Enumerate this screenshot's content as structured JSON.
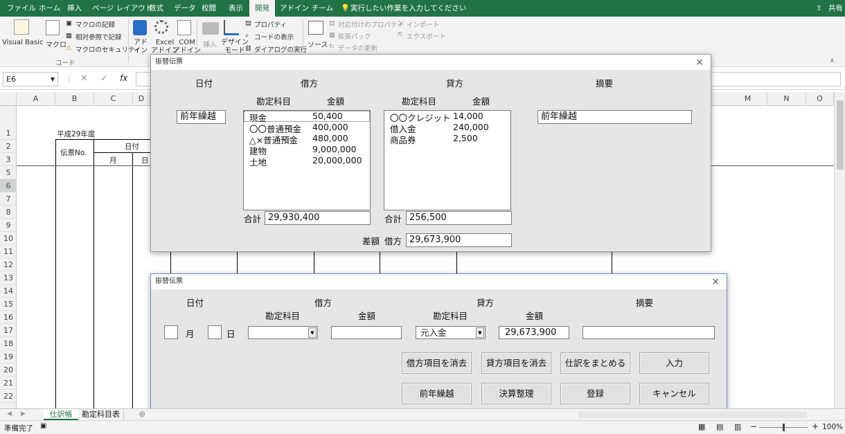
{
  "ribbon": {
    "tabs": [
      "ファイル",
      "ホーム",
      "挿入",
      "ページ レイアウト",
      "数式",
      "データ",
      "校閲",
      "表示",
      "開発",
      "アドイン",
      "チーム"
    ],
    "active_tab": "開発",
    "tellme": "実行したい作業を入力してください",
    "share": "共有",
    "code": {
      "vb": "Visual Basic",
      "macro": "マクロ",
      "record": "マクロの記録",
      "relative": "相対参照で記録",
      "security": "マクロのセキュリティ",
      "group": "コード"
    },
    "addins": {
      "addin": "アド\nイン",
      "excel_addin": "Excel\nアドイン",
      "com_addin": "COM\nアドイン"
    },
    "controls": {
      "insert": "挿入",
      "design": "デザイン\nモード",
      "properties": "プロパティ",
      "view_code": "コードの表示",
      "run_dialog": "ダイアログの実行"
    },
    "xml": {
      "source": "ソース",
      "map_props": "対応付けのプロパティ",
      "expansion": "拡張パック",
      "refresh": "データの更新",
      "import": "インポート",
      "export": "エクスポート"
    }
  },
  "formula_bar": {
    "namebox": "E6",
    "fx": "fx"
  },
  "columns": [
    "A",
    "B",
    "C",
    "",
    "M",
    "N",
    "O"
  ],
  "rows": [
    "1",
    "2",
    "3",
    "5",
    "6",
    "7",
    "8",
    "9",
    "10",
    "11",
    "12",
    "13",
    "14",
    "15",
    "16",
    "17",
    "18",
    "19",
    "20",
    "21",
    "22"
  ],
  "sheet": {
    "year": "平成29年度",
    "voucher_no": "伝票No.",
    "date": "日付",
    "month": "月",
    "day": "日"
  },
  "dialog1": {
    "title": "振替伝票",
    "close": "×",
    "hdr_date": "日付",
    "hdr_debit": "借方",
    "hdr_credit": "貸方",
    "hdr_memo": "摘要",
    "hdr_account1": "勘定科目",
    "hdr_amount1": "金額",
    "hdr_account2": "勘定科目",
    "hdr_amount2": "金額",
    "date_value": "前年繰越",
    "memo_value": "前年繰越",
    "debit_items": [
      [
        "現金",
        "50,400"
      ],
      [
        "〇〇普通預金",
        "400,000"
      ],
      [
        "△×普通預金",
        "480,000"
      ],
      [
        "建物",
        "9,000,000"
      ],
      [
        "土地",
        "20,000,000"
      ]
    ],
    "credit_items": [
      [
        "〇〇クレジット",
        "14,000"
      ],
      [
        "借入金",
        "240,000"
      ],
      [
        "商品券",
        "2,500"
      ]
    ],
    "total_label1": "合計",
    "debit_total": "29,930,400",
    "total_label2": "合計",
    "credit_total": "256,500",
    "diff_label": "差額",
    "diff_side": "借方",
    "diff_value": "29,673,900"
  },
  "dialog2": {
    "title": "振替伝票",
    "close": "×",
    "hdr_date": "日付",
    "hdr_debit": "借方",
    "hdr_credit": "貸方",
    "hdr_memo": "摘要",
    "hdr_account1": "勘定科目",
    "hdr_amount1": "金額",
    "hdr_account2": "勘定科目",
    "hdr_amount2": "金額",
    "month_label": "月",
    "day_label": "日",
    "credit_account": "元入金",
    "credit_amount": "29,673,900",
    "buttons": {
      "clear_debit": "借方項目を消去",
      "clear_credit": "貸方項目を消去",
      "summarize": "仕訳をまとめる",
      "enter": "入力",
      "carry": "前年繰越",
      "closing": "決算整理",
      "register": "登録",
      "cancel": "キャンセル"
    }
  },
  "sheet_tabs": [
    "仕訳帳",
    "勘定科目表"
  ],
  "status": {
    "ready": "準備完了",
    "zoom": "100%"
  }
}
